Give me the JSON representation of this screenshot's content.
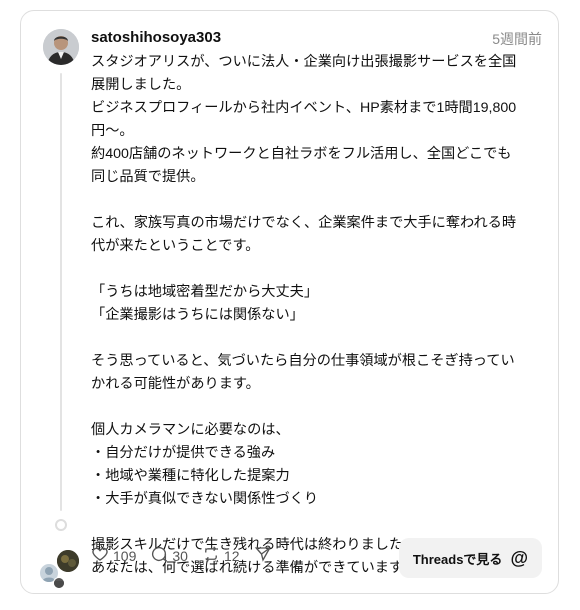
{
  "post": {
    "username": "satoshihosoya303",
    "timestamp": "5週間前",
    "lines": [
      "スタジオアリスが、ついに法人・企業向け出張撮影サービスを全国",
      "展開しました。",
      "ビジネスプロフィールから社内イベント、HP素材まで1時間19,800",
      "円〜。",
      "約400店舗のネットワークと自社ラボをフル活用し、全国どこでも",
      "同じ品質で提供。",
      "",
      "これ、家族写真の市場だけでなく、企業案件まで大手に奪われる時",
      "代が来たということです。",
      "",
      "「うちは地域密着型だから大丈夫」",
      "「企業撮影はうちには関係ない」",
      "",
      "そう思っていると、気づいたら自分の仕事領域が根こそぎ持ってい",
      "かれる可能性があります。",
      "",
      "個人カメラマンに必要なのは、",
      "・自分だけが提供できる強み",
      "・地域や業種に特化した提案力",
      "・大手が真似できない関係性づくり",
      "",
      "撮影スキルだけで生き残れる時代は終わりました。",
      "あなたは、何で選ばれ続ける準備ができていますか？"
    ]
  },
  "actions": {
    "likes": "109",
    "replies": "30",
    "reposts": "12"
  },
  "threads_button": {
    "label": "Threadsで見る",
    "logo": "@"
  },
  "icons": {
    "like": "heart-icon",
    "reply": "comment-icon",
    "repost": "repost-icon",
    "share": "send-icon"
  }
}
